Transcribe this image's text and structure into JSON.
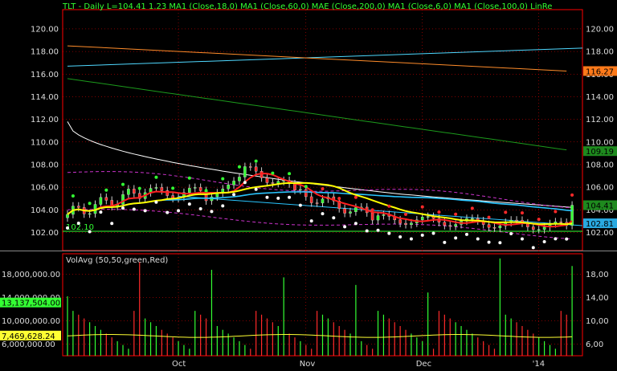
{
  "header": {
    "text": "TLT - Daily  L=104.41  1.23  MA1 (Close,18,0)  MA1 (Close,60,0)  MAE (Close,200,0)  MA1 (Close,6,0)  MA1 (Close,100,0)  LinRe",
    "color": "#33ff33"
  },
  "price_axis": {
    "ticks": [
      "120.00",
      "118.00",
      "116.00",
      "114.00",
      "112.00",
      "110.00",
      "108.00",
      "106.00",
      "104.00",
      "102.00"
    ],
    "range": [
      100.4,
      121.7
    ]
  },
  "price_badges": [
    {
      "text": "116.27",
      "value": 116.27,
      "color": "#ff7a1a"
    },
    {
      "text": "109.19",
      "value": 109.19,
      "color": "#1e8a1e"
    },
    {
      "text": "104.41",
      "value": 104.41,
      "color": "#1e8a1e"
    },
    {
      "text": "102.81",
      "value": 102.81,
      "color": "#29a9e0"
    }
  ],
  "left_price_label": {
    "text": "102.10",
    "value": 102.1
  },
  "volume_panel": {
    "title": "VolAvg (50,50,green,Red)",
    "ticks": [
      "18,000,000.00",
      "14,000,000.00",
      "10,000,000.00",
      "6,000,000.00"
    ],
    "right_ticks": [
      "18,00",
      "14,00",
      "10,00",
      "6,00"
    ],
    "range": [
      4000000,
      21500000
    ],
    "badges": [
      {
        "text": "13,137,504.00",
        "value": 13137504,
        "color": "#33ff33"
      },
      {
        "text": "7,469,628.24",
        "value": 7469628.24,
        "color": "#ffff33"
      }
    ]
  },
  "x_axis": {
    "labels": [
      {
        "text": "Oct",
        "index": 20
      },
      {
        "text": "Nov",
        "index": 43
      },
      {
        "text": "Dec",
        "index": 64
      },
      {
        "text": "'14",
        "index": 85
      }
    ],
    "bars": 92
  },
  "colors": {
    "background": "#000000",
    "grid": "#ff0000",
    "up": "#33ff33",
    "down": "#ff2a2a",
    "ma18": "#ffff00",
    "ma60": "#29c5ff",
    "ma6": "#ff2020",
    "ma100": "#ffffff",
    "mae200": "#1c9a1c",
    "linreg": "#ff8c2a",
    "channel": "#cc33cc"
  }
}
